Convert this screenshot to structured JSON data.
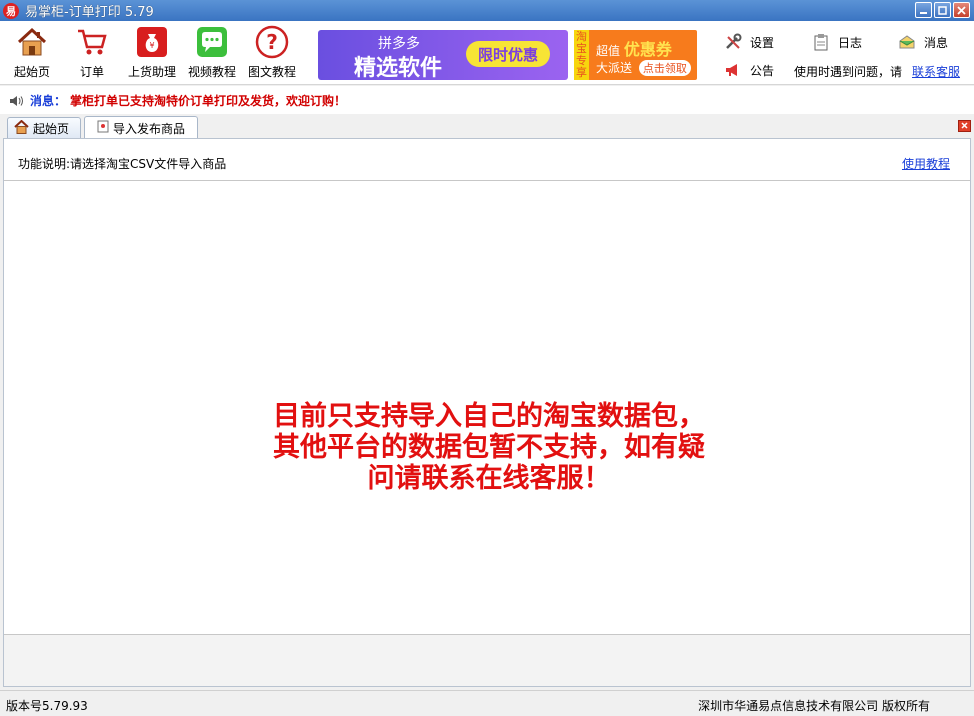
{
  "window": {
    "title": "易掌柜-订单打印 5.79",
    "app_icon_glyph": "易"
  },
  "toolbar": {
    "items": [
      {
        "label": "起始页",
        "icon": "home-icon"
      },
      {
        "label": "订单",
        "icon": "cart-icon"
      },
      {
        "label": "上货助理",
        "icon": "money-bag-icon"
      },
      {
        "label": "视频教程",
        "icon": "chat-bubble-icon"
      },
      {
        "label": "图文教程",
        "icon": "help-icon"
      }
    ],
    "banner_pdd": {
      "small": "拼多多",
      "big": "精选软件",
      "pill": "限时优惠"
    },
    "banner_tb": {
      "side": "淘宝专享",
      "top_prefix": "超值",
      "top_highlight": "优惠券",
      "bottom": "大派送",
      "pill": "点击领取"
    },
    "right": {
      "settings": "设置",
      "log": "日志",
      "messages": "消息",
      "notice": "公告",
      "help_text": "使用时遇到问题，请",
      "service_link": "联系客服"
    }
  },
  "message_bar": {
    "label": "消息：",
    "text": "掌柜打单已支持淘特价订单打印及发货，欢迎订购！"
  },
  "tabs": [
    {
      "label": "起始页",
      "icon": "home-icon"
    },
    {
      "label": "导入发布商品",
      "icon": "document-icon",
      "active": true
    }
  ],
  "panel": {
    "description": "功能说明:请选择淘宝CSV文件导入商品",
    "tutorial_link": "使用教程",
    "notice_lines": [
      "目前只支持导入自己的淘宝数据包，",
      "其他平台的数据包暂不支持，如有疑",
      "问请联系在线客服！"
    ]
  },
  "status_bar": {
    "version": "版本号5.79.93",
    "copyright": "深圳市华通易点信息技术有限公司 版权所有"
  },
  "colors": {
    "title_bar": "#3a74c2",
    "link": "#1a3fd8",
    "alert_red": "#e21010",
    "banner_purple": "#7b57e8",
    "banner_orange": "#f77b1c"
  }
}
